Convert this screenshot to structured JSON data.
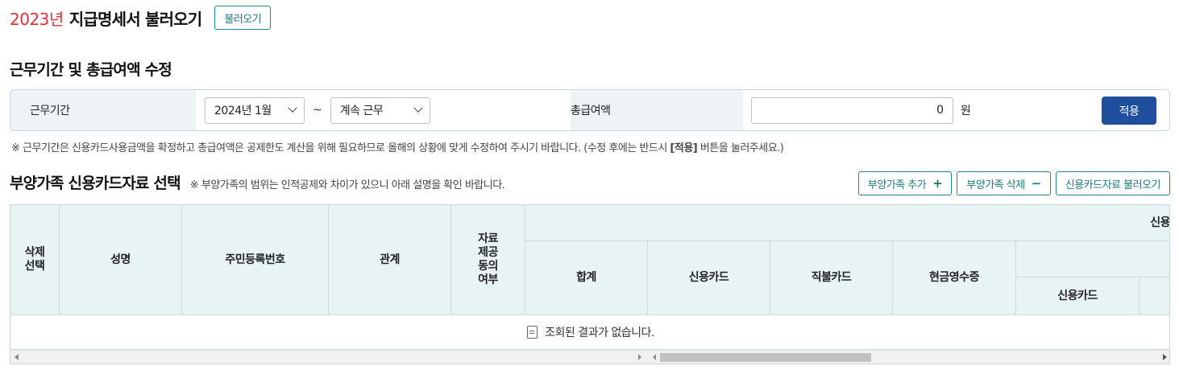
{
  "header": {
    "year": "2023년",
    "title": "지급명세서 불러오기",
    "load_button": "불러오기"
  },
  "period_section": {
    "title": "근무기간 및 총급여액 수정",
    "period_label": "근무기간",
    "start_select": "2024년 1월",
    "separator": "~",
    "end_select": "계속 근무",
    "salary_label": "총급여액",
    "salary_value": "0",
    "unit": "원",
    "apply_button": "적용",
    "note_prefix": "※ 근무기간은 신용카드사용금액을 확정하고 총급여액은 공제한도 계산을 위해 필요하므로 올해의 상황에 맞게 수정하여 주시기 바랍니다. (수정 후에는 반드시 ",
    "note_bold": "[적용]",
    "note_suffix": " 버튼을 눌러주세요.)"
  },
  "dependents_section": {
    "title": "부양가족 신용카드자료 선택",
    "note": "※ 부양가족의 범위는 인적공제와 차이가 있으니 아래 설명을 확인 바랍니다.",
    "add_button": "부양가족 추가",
    "delete_button": "부양가족 삭제",
    "load_card_button": "신용카드자료 불러오기",
    "table": {
      "headers": {
        "delete_select": "삭제\n선택",
        "name": "성명",
        "resident_no": "주민등록번호",
        "relation": "관계",
        "consent": "자료\n제공\n동의\n여부",
        "card_group": "신용",
        "total": "합계",
        "credit_card": "신용카드",
        "debit_card": "직불카드",
        "cash_receipt": "현금영수증",
        "sub_group": "",
        "sub_credit_card": "신용카드"
      },
      "empty_message": "조회된 결과가 없습니다."
    }
  },
  "icons": {
    "add": "plus-icon",
    "delete": "minus-icon",
    "empty": "document-icon",
    "select": "chevron-down-icon"
  },
  "colors": {
    "year": "#e0323a",
    "apply_button": "#1f4e9d",
    "outline_button": "#1e7a7a",
    "table_header": "#e8f4f4"
  }
}
